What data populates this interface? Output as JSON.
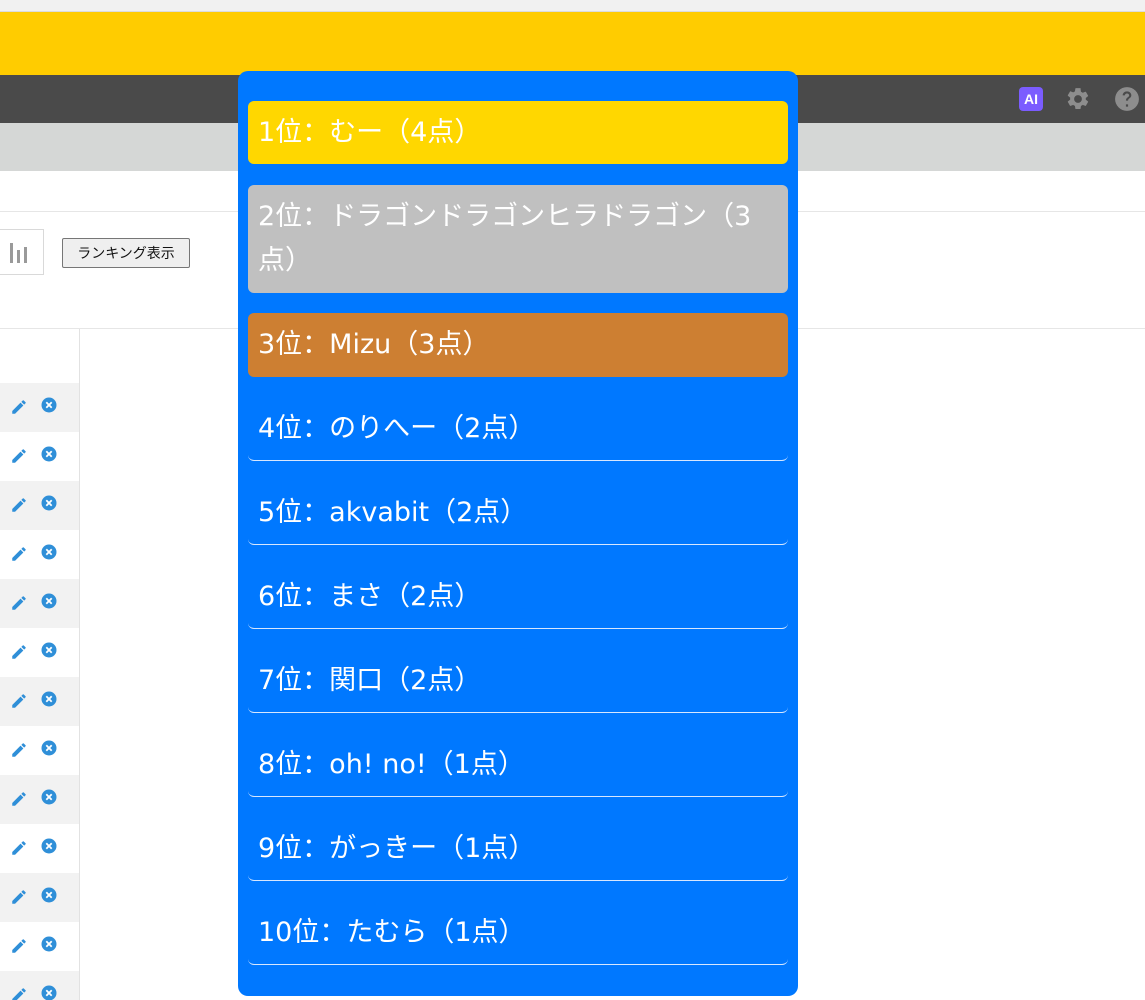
{
  "toolbar": {
    "ai_label": "AI",
    "ranking_button_label": "ランキング表示"
  },
  "ranking": {
    "items": [
      {
        "text": "1位：むー（4点）",
        "rank": 1,
        "points": 4
      },
      {
        "text": "2位：ドラゴンドラゴンヒラドラゴン（3点）",
        "rank": 2,
        "points": 3
      },
      {
        "text": "3位：Mizu（3点）",
        "rank": 3,
        "points": 3
      },
      {
        "text": "4位：のりへー（2点）",
        "rank": 4,
        "points": 2
      },
      {
        "text": "5位：akvabit（2点）",
        "rank": 5,
        "points": 2
      },
      {
        "text": "6位：まさ（2点）",
        "rank": 6,
        "points": 2
      },
      {
        "text": "7位：関口（2点）",
        "rank": 7,
        "points": 2
      },
      {
        "text": "8位：oh! no!（1点）",
        "rank": 8,
        "points": 1
      },
      {
        "text": "9位：がっきー（1点）",
        "rank": 9,
        "points": 1
      },
      {
        "text": "10位：たむら（1点）",
        "rank": 10,
        "points": 1
      }
    ]
  },
  "colors": {
    "header_yellow": "#ffcc00",
    "nav_dark": "#4a4a4a",
    "panel_blue": "#0078ff",
    "gold": "#ffd700",
    "silver": "#c0c0c0",
    "bronze": "#cd7f32",
    "ai_purple": "#7b5cff",
    "edit_blue": "#2f8fd8"
  },
  "icons": {
    "header": [
      "ai-icon",
      "gear-icon",
      "help-icon"
    ],
    "chart": "bar-chart-icon",
    "row_actions": [
      "pencil-icon",
      "remove-icon"
    ]
  }
}
